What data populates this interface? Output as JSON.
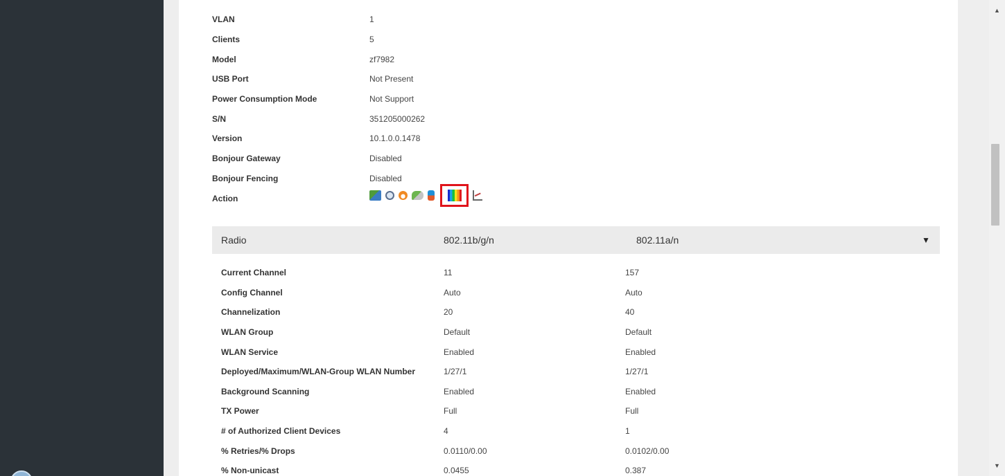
{
  "info": [
    {
      "key": "VLAN",
      "value": "1"
    },
    {
      "key": "Clients",
      "value": "5"
    },
    {
      "key": "Model",
      "value": "zf7982"
    },
    {
      "key": "USB Port",
      "value": "Not Present"
    },
    {
      "key": "Power Consumption Mode",
      "value": "Not Support"
    },
    {
      "key": "S/N",
      "value": "351205000262"
    },
    {
      "key": "Version",
      "value": "10.1.0.0.1478"
    },
    {
      "key": "Bonjour Gateway",
      "value": "Disabled"
    },
    {
      "key": "Bonjour Fencing",
      "value": "Disabled"
    }
  ],
  "action_label": "Action",
  "action_icons": [
    "map-icon",
    "restart-icon",
    "speedflex-icon",
    "chat-icon",
    "swap-icon",
    "spectrum-analysis-icon",
    "chart-icon"
  ],
  "highlight_color": "#e0141b",
  "radio": {
    "header": [
      "Radio",
      "802.11b/g/n",
      "802.11a/n"
    ],
    "caret_icon": "caret-down-icon",
    "rows": [
      {
        "key": "Current Channel",
        "v1": "11",
        "v2": "157"
      },
      {
        "key": "Config Channel",
        "v1": "Auto",
        "v2": "Auto"
      },
      {
        "key": "Channelization",
        "v1": "20",
        "v2": "40"
      },
      {
        "key": "WLAN Group",
        "v1": "Default",
        "v2": "Default"
      },
      {
        "key": "WLAN Service",
        "v1": "Enabled",
        "v2": "Enabled"
      },
      {
        "key": "Deployed/Maximum/WLAN-Group WLAN Number",
        "v1": "1/27/1",
        "v2": "1/27/1"
      },
      {
        "key": "Background Scanning",
        "v1": "Enabled",
        "v2": "Enabled"
      },
      {
        "key": "TX Power",
        "v1": "Full",
        "v2": "Full"
      },
      {
        "key": "# of Authorized Client Devices",
        "v1": "4",
        "v2": "1"
      },
      {
        "key": "% Retries/% Drops",
        "v1": "0.0110/0.00",
        "v2": "0.0102/0.00"
      },
      {
        "key": "% Non-unicast",
        "v1": "0.0455",
        "v2": "0.387"
      }
    ]
  }
}
